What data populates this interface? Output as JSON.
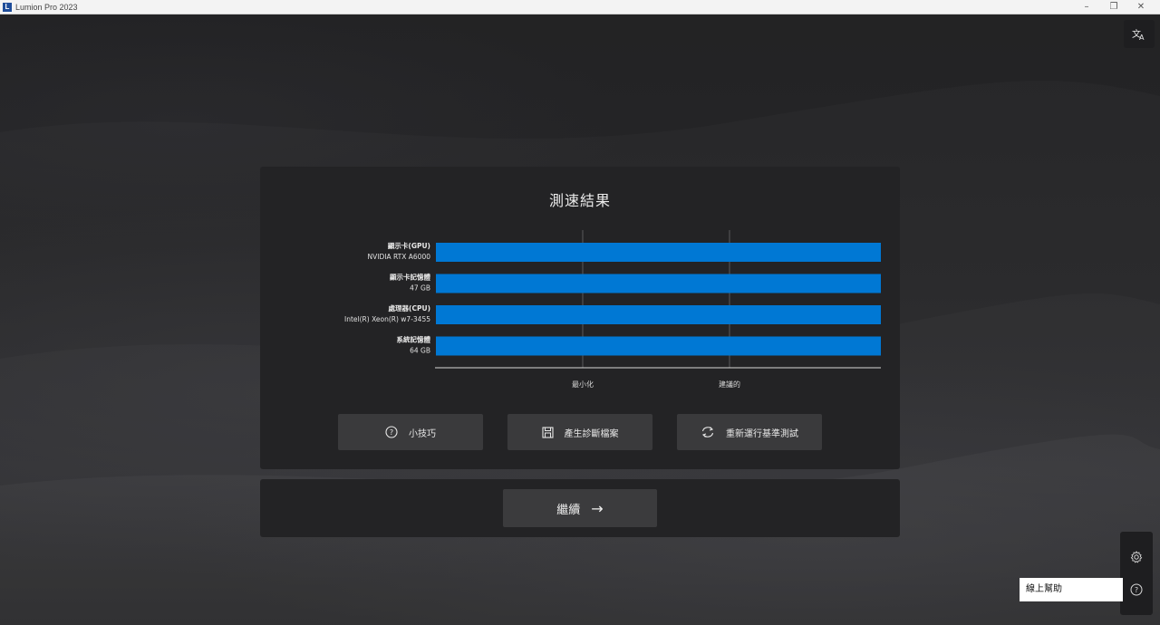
{
  "window": {
    "title": "Lumion Pro 2023",
    "logo_letter": "L",
    "controls": {
      "minimize": "–",
      "restore": "❐",
      "close": "✕"
    }
  },
  "results": {
    "title": "測速結果",
    "rows": [
      {
        "name": "顯示卡(GPU)",
        "value": "NVIDIA RTX A6000",
        "score": 1.0
      },
      {
        "name": "顯示卡記憶體",
        "value": "47 GB",
        "score": 1.0
      },
      {
        "name": "處理器(CPU)",
        "value": "Intel(R) Xeon(R) w7-3455",
        "score": 1.0
      },
      {
        "name": "系統記憶體",
        "value": "64 GB",
        "score": 1.0
      }
    ],
    "axis_labels": [
      "最小化",
      "建議的"
    ],
    "bar_color": "#0078d4"
  },
  "actions": {
    "tips": {
      "label": "小技巧",
      "icon": "question-circle-icon"
    },
    "diagnostic": {
      "label": "產生診斷檔案",
      "icon": "save-icon"
    },
    "rerun": {
      "label": "重新運行基準測試",
      "icon": "refresh-icon"
    }
  },
  "continue": {
    "label": "繼續",
    "arrow": "→"
  },
  "side": {
    "settings_icon": "gear-icon",
    "help_icon": "help-circle-icon",
    "tooltip": "線上幫助"
  },
  "translate_icon": "translate-icon"
}
